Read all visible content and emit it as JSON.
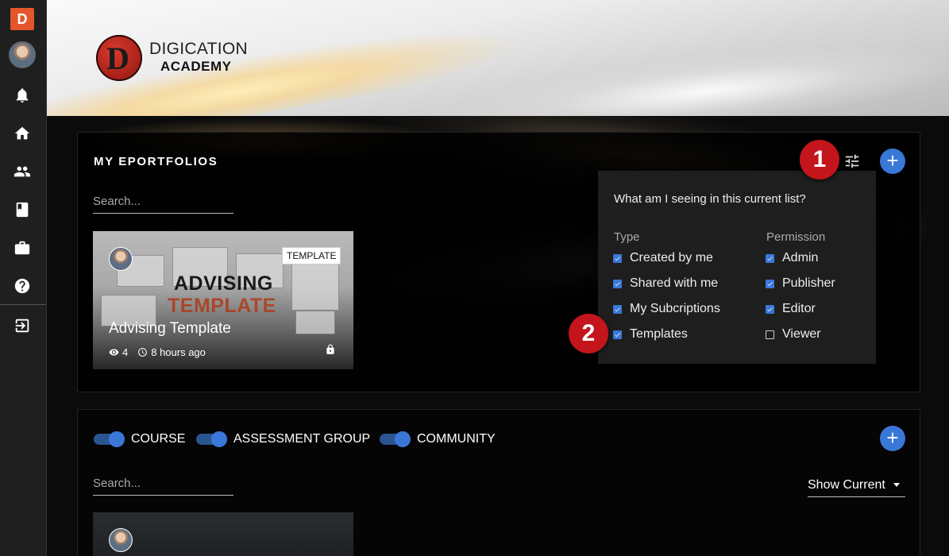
{
  "sidebar": {
    "logo_letter": "D",
    "items": [
      {
        "name": "notifications",
        "icon": "bell-icon"
      },
      {
        "name": "home",
        "icon": "home-icon"
      },
      {
        "name": "people",
        "icon": "people-icon"
      },
      {
        "name": "library",
        "icon": "book-icon"
      },
      {
        "name": "portfolio",
        "icon": "briefcase-icon"
      },
      {
        "name": "help",
        "icon": "help-icon"
      },
      {
        "name": "logout",
        "icon": "logout-icon"
      }
    ]
  },
  "brand": {
    "line1": "DIGICATION",
    "line2": "ACADEMY",
    "mark_letter": "D"
  },
  "eportfolios": {
    "title": "MY EPORTFOLIOS",
    "search_placeholder": "Search...",
    "card": {
      "tag": "TEMPLATE",
      "headline": "ADVISING",
      "headline2": "TEMPLATE",
      "title": "Advising Template",
      "views": "4",
      "time": "8 hours ago"
    }
  },
  "annotations": {
    "badge1": "1",
    "badge2": "2"
  },
  "filter_dropdown": {
    "question": "What am I seeing in this current list?",
    "type_header": "Type",
    "permission_header": "Permission",
    "type_options": [
      {
        "label": "Created by me",
        "checked": true
      },
      {
        "label": "Shared with me",
        "checked": true
      },
      {
        "label": "My Subcriptions",
        "checked": true
      },
      {
        "label": "Templates",
        "checked": true
      }
    ],
    "permission_options": [
      {
        "label": "Admin",
        "checked": true
      },
      {
        "label": "Publisher",
        "checked": true
      },
      {
        "label": "Editor",
        "checked": true
      },
      {
        "label": "Viewer",
        "checked": false
      }
    ]
  },
  "groups": {
    "toggles": [
      {
        "label": "COURSE",
        "on": true
      },
      {
        "label": "ASSESSMENT GROUP",
        "on": true
      },
      {
        "label": "COMMUNITY",
        "on": true
      }
    ],
    "search_placeholder": "Search...",
    "show_current": "Show Current"
  },
  "colors": {
    "accent": "#3a78d8",
    "brand": "#e4552b",
    "badge": "#c4151c"
  }
}
